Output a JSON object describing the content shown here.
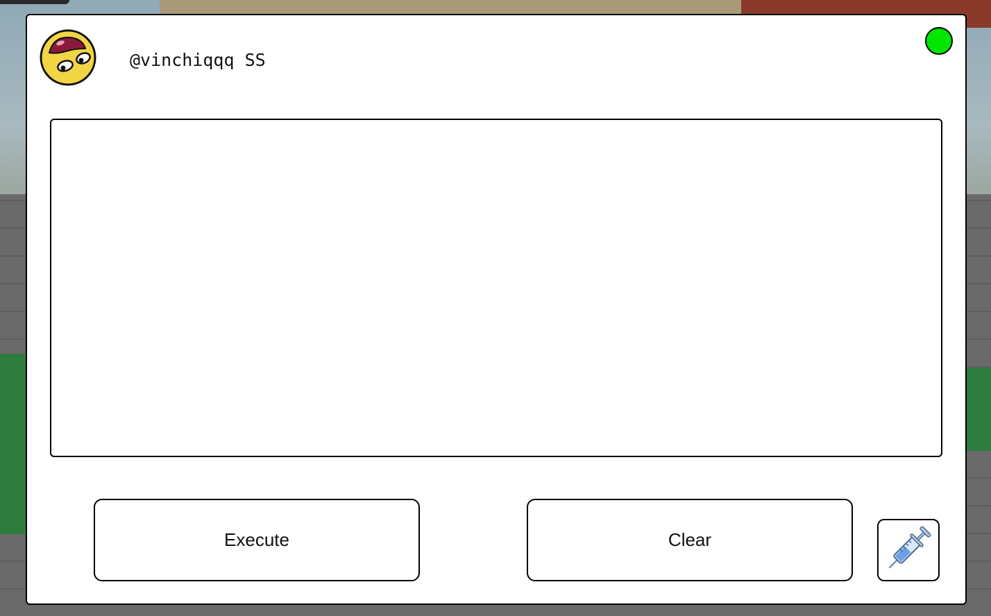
{
  "header": {
    "username": "@vinchiqqq SS",
    "status_color": "#00e600",
    "avatar_icon": "awesome-face-icon"
  },
  "editor": {
    "value": "",
    "placeholder": ""
  },
  "buttons": {
    "execute_label": "Execute",
    "clear_label": "Clear",
    "inject_icon": "syringe-icon"
  }
}
